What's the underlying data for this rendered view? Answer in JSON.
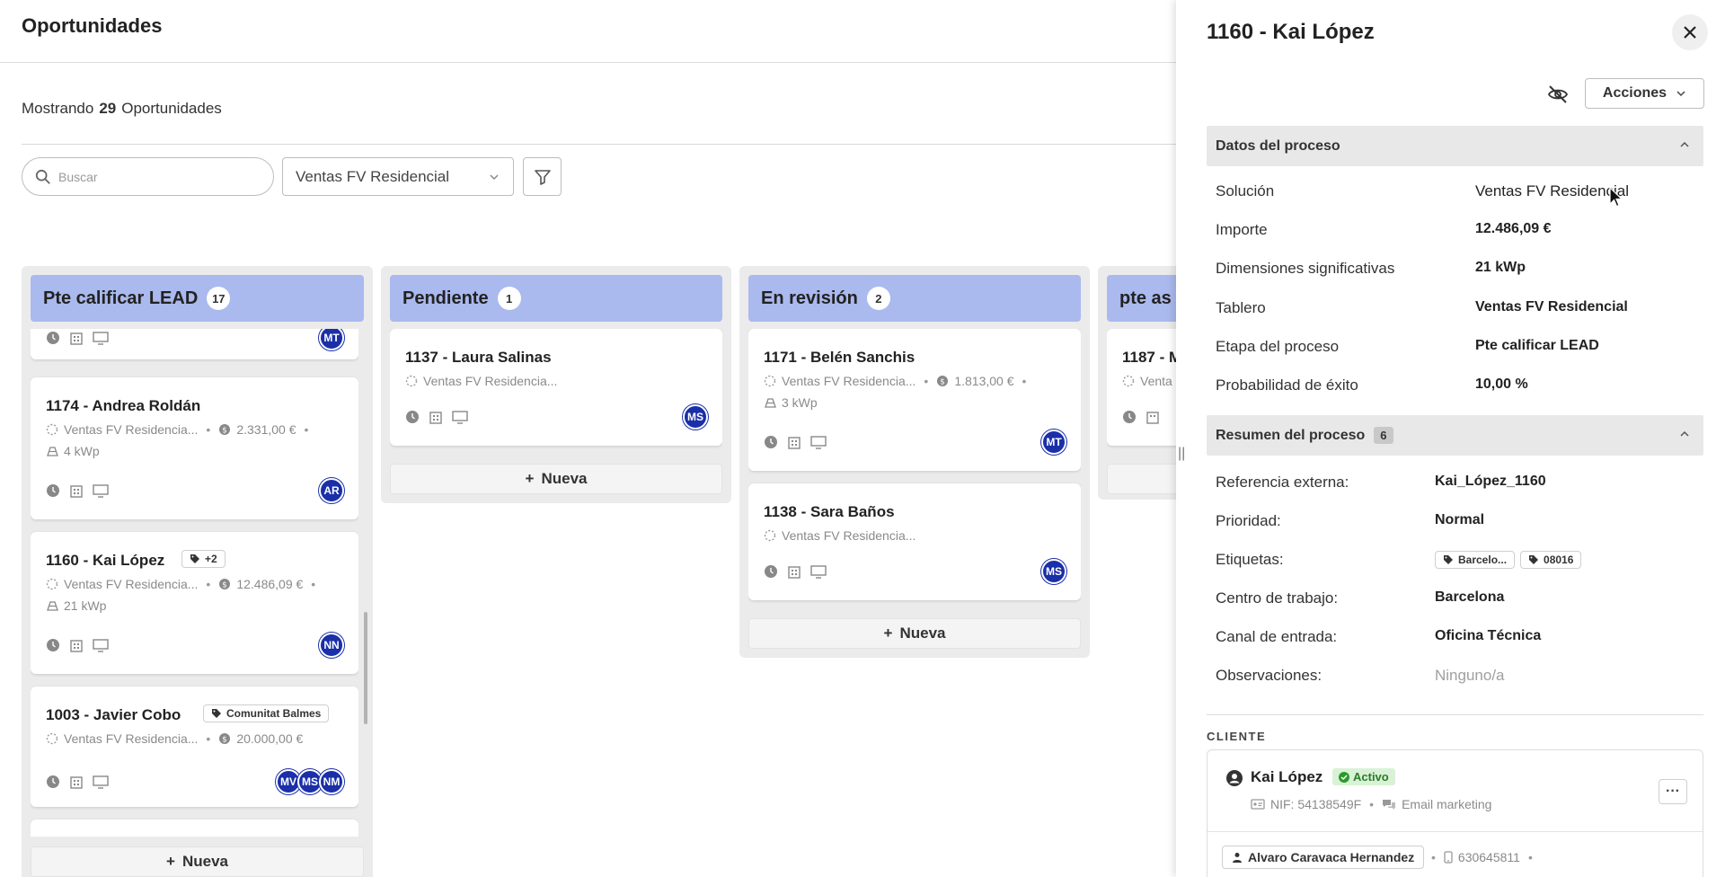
{
  "page": {
    "title": "Oportunidades",
    "showing_prefix": "Mostrando",
    "showing_count": "29",
    "showing_suffix": "Oportunidades",
    "search_placeholder": "Buscar",
    "board_selected": "Ventas FV Residencial"
  },
  "columns": [
    {
      "title": "Pte calificar LEAD",
      "count": "17",
      "new_label": "Nueva",
      "cards": [
        {
          "title": "",
          "solution": "",
          "amount": "",
          "power": "",
          "avatars": [
            "MT"
          ]
        },
        {
          "title": "1174 - Andrea Roldán",
          "solution": "Ventas FV Residencia...",
          "amount": "2.331,00 €",
          "power": "4 kWp",
          "avatars": [
            "AR"
          ]
        },
        {
          "title": "1160 - Kai López",
          "tag": "+2",
          "solution": "Ventas FV Residencia...",
          "amount": "12.486,09 €",
          "power": "21 kWp",
          "avatars": [
            "NN"
          ]
        },
        {
          "title": "1003 - Javier Cobo",
          "tag": "Comunitat Balmes",
          "solution": "Ventas FV Residencia...",
          "amount": "20.000,00 €",
          "power": "",
          "avatars": [
            "MV",
            "MS",
            "NM"
          ]
        }
      ]
    },
    {
      "title": "Pendiente",
      "count": "1",
      "new_label": "Nueva",
      "cards": [
        {
          "title": "1137 - Laura Salinas",
          "solution": "Ventas FV Residencia...",
          "amount": "",
          "power": "",
          "avatars": [
            "MS"
          ]
        }
      ]
    },
    {
      "title": "En revisión",
      "count": "2",
      "new_label": "Nueva",
      "cards": [
        {
          "title": "1171 - Belén Sanchis",
          "solution": "Ventas FV Residencia...",
          "amount": "1.813,00 €",
          "power": "3 kWp",
          "avatars": [
            "MT"
          ]
        },
        {
          "title": "1138 - Sara Baños",
          "solution": "Ventas FV Residencia...",
          "amount": "",
          "power": "",
          "avatars": [
            "MS"
          ]
        }
      ]
    },
    {
      "title": "pte as",
      "count": "",
      "cards": [
        {
          "title": "1187 - M",
          "solution": "Venta"
        }
      ]
    }
  ],
  "drawer": {
    "title": "1160 - Kai López",
    "actions_label": "Acciones",
    "process_section": {
      "title": "Datos del proceso",
      "rows": [
        {
          "label": "Solución",
          "value": "Ventas FV Residencial"
        },
        {
          "label": "Importe",
          "value": "12.486,09 €"
        },
        {
          "label": "Dimensiones significativas",
          "value": "21 kWp"
        },
        {
          "label": "Tablero",
          "value": "Ventas FV Residencial"
        },
        {
          "label": "Etapa del proceso",
          "value": "Pte calificar LEAD"
        },
        {
          "label": "Probabilidad de éxito",
          "value": "10,00 %"
        }
      ]
    },
    "summary_section": {
      "title": "Resumen del proceso",
      "count": "6",
      "rows": [
        {
          "label": "Referencia externa:",
          "value": "Kai_López_1160"
        },
        {
          "label": "Prioridad:",
          "value": "Normal"
        },
        {
          "label": "Etiquetas:",
          "tags": [
            "Barcelo...",
            "08016"
          ]
        },
        {
          "label": "Centro de trabajo:",
          "value": "Barcelona"
        },
        {
          "label": "Canal de entrada:",
          "value": "Oficina Técnica"
        },
        {
          "label": "Observaciones:",
          "value": "Ninguno/a"
        }
      ]
    },
    "client": {
      "section_label": "CLIENTE",
      "name": "Kai López",
      "status": "Activo",
      "nif": "NIF: 54138549F",
      "channel": "Email marketing",
      "contact_name": "Alvaro Caravaca Hernandez",
      "contact_phone": "630645811"
    }
  },
  "colors": {
    "column_header": "#aab9ee",
    "avatar": "#1a2fa8",
    "status_active_bg": "#d9f2d6",
    "status_active_text": "#2c7a2a"
  }
}
